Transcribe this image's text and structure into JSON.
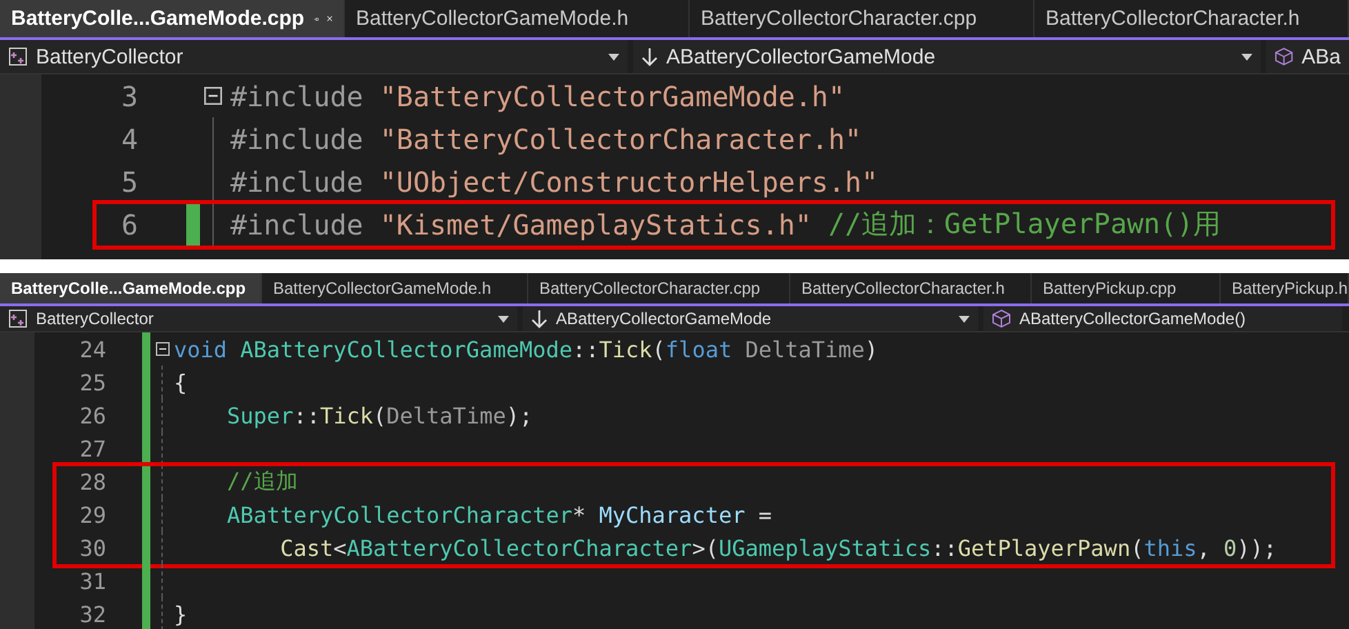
{
  "panes": [
    {
      "tabs": [
        {
          "label": "BatteryColle...GameMode.cpp",
          "selected": true
        },
        {
          "label": "BatteryCollectorGameMode.h",
          "selected": false
        },
        {
          "label": "BatteryCollectorCharacter.cpp",
          "selected": false
        },
        {
          "label": "BatteryCollectorCharacter.h",
          "selected": false
        }
      ],
      "nav": {
        "project": "BatteryCollector",
        "scope": "ABatteryCollectorGameMode",
        "member": "ABa"
      },
      "blocks": [
        {
          "highlighted": false,
          "lines": [
            {
              "number": "3",
              "changed": false,
              "fold": true,
              "tokens": [
                {
                  "kind": "pre",
                  "text": "#include"
                },
                {
                  "kind": "str",
                  "text": " \"BatteryCollectorGameMode.h\""
                }
              ]
            },
            {
              "number": "4",
              "changed": false,
              "fold": false,
              "tokens": [
                {
                  "kind": "pre",
                  "text": "#include"
                },
                {
                  "kind": "str",
                  "text": " \"BatteryCollectorCharacter.h\""
                }
              ]
            },
            {
              "number": "5",
              "changed": false,
              "fold": false,
              "tokens": [
                {
                  "kind": "pre",
                  "text": "#include"
                },
                {
                  "kind": "str",
                  "text": " \"UObject/ConstructorHelpers.h\""
                }
              ]
            }
          ]
        },
        {
          "highlighted": true,
          "lines": [
            {
              "number": "6",
              "changed": true,
              "fold": false,
              "tokens": [
                {
                  "kind": "pre",
                  "text": "#include"
                },
                {
                  "kind": "str",
                  "text": " \"Kismet/GameplayStatics.h\""
                },
                {
                  "kind": "com",
                  "text": " //追加：GetPlayerPawn()用"
                }
              ]
            }
          ]
        }
      ]
    },
    {
      "tabs": [
        {
          "label": "BatteryColle...GameMode.cpp",
          "selected": true
        },
        {
          "label": "BatteryCollectorGameMode.h",
          "selected": false
        },
        {
          "label": "BatteryCollectorCharacter.cpp",
          "selected": false
        },
        {
          "label": "BatteryCollectorCharacter.h",
          "selected": false
        },
        {
          "label": "BatteryPickup.cpp",
          "selected": false
        },
        {
          "label": "BatteryPickup.h",
          "selected": false
        }
      ],
      "nav": {
        "project": "BatteryCollector",
        "scope": "ABatteryCollectorGameMode",
        "member": "ABatteryCollectorGameMode()"
      },
      "blocks": [
        {
          "highlighted": false,
          "lines": [
            {
              "number": "24",
              "changed": true,
              "fold": true,
              "tokens": [
                {
                  "kind": "kw",
                  "text": "void"
                },
                {
                  "kind": "type",
                  "text": " ABatteryCollectorGameMode"
                },
                {
                  "kind": "plain",
                  "text": "::"
                },
                {
                  "kind": "fn",
                  "text": "Tick"
                },
                {
                  "kind": "plain",
                  "text": "("
                },
                {
                  "kind": "kw",
                  "text": "float"
                },
                {
                  "kind": "param",
                  "text": " DeltaTime"
                },
                {
                  "kind": "plain",
                  "text": ")"
                }
              ]
            },
            {
              "number": "25",
              "changed": true,
              "fold": false,
              "tokens": [
                {
                  "kind": "plain",
                  "text": "{"
                }
              ]
            },
            {
              "number": "26",
              "changed": true,
              "fold": false,
              "tokens": [
                {
                  "kind": "type",
                  "text": "    Super"
                },
                {
                  "kind": "plain",
                  "text": "::"
                },
                {
                  "kind": "fn",
                  "text": "Tick"
                },
                {
                  "kind": "plain",
                  "text": "("
                },
                {
                  "kind": "param",
                  "text": "DeltaTime"
                },
                {
                  "kind": "plain",
                  "text": ");"
                }
              ]
            },
            {
              "number": "27",
              "changed": true,
              "fold": false
            }
          ]
        },
        {
          "highlighted": true,
          "lines": [
            {
              "number": "28",
              "changed": true,
              "fold": false,
              "tokens": [
                {
                  "kind": "com",
                  "text": "    //追加"
                }
              ]
            },
            {
              "number": "29",
              "changed": true,
              "fold": false,
              "tokens": [
                {
                  "kind": "type",
                  "text": "    ABatteryCollectorCharacter"
                },
                {
                  "kind": "plain",
                  "text": "* "
                },
                {
                  "kind": "var",
                  "text": "MyCharacter"
                },
                {
                  "kind": "plain",
                  "text": " ="
                }
              ]
            },
            {
              "number": "30",
              "changed": true,
              "fold": false,
              "tokens": [
                {
                  "kind": "fn",
                  "text": "        Cast"
                },
                {
                  "kind": "plain",
                  "text": "<"
                },
                {
                  "kind": "type",
                  "text": "ABatteryCollectorCharacter"
                },
                {
                  "kind": "plain",
                  "text": ">("
                },
                {
                  "kind": "type",
                  "text": "UGameplayStatics"
                },
                {
                  "kind": "plain",
                  "text": "::"
                },
                {
                  "kind": "fn",
                  "text": "GetPlayerPawn"
                },
                {
                  "kind": "plain",
                  "text": "("
                },
                {
                  "kind": "kw",
                  "text": "this"
                },
                {
                  "kind": "plain",
                  "text": ", "
                },
                {
                  "kind": "num",
                  "text": "0"
                },
                {
                  "kind": "plain",
                  "text": "));"
                }
              ]
            }
          ]
        },
        {
          "highlighted": false,
          "lines": [
            {
              "number": "31",
              "changed": true,
              "fold": false
            },
            {
              "number": "32",
              "changed": true,
              "fold": false,
              "tokens": [
                {
                  "kind": "plain",
                  "text": "}"
                }
              ]
            }
          ]
        }
      ]
    }
  ]
}
